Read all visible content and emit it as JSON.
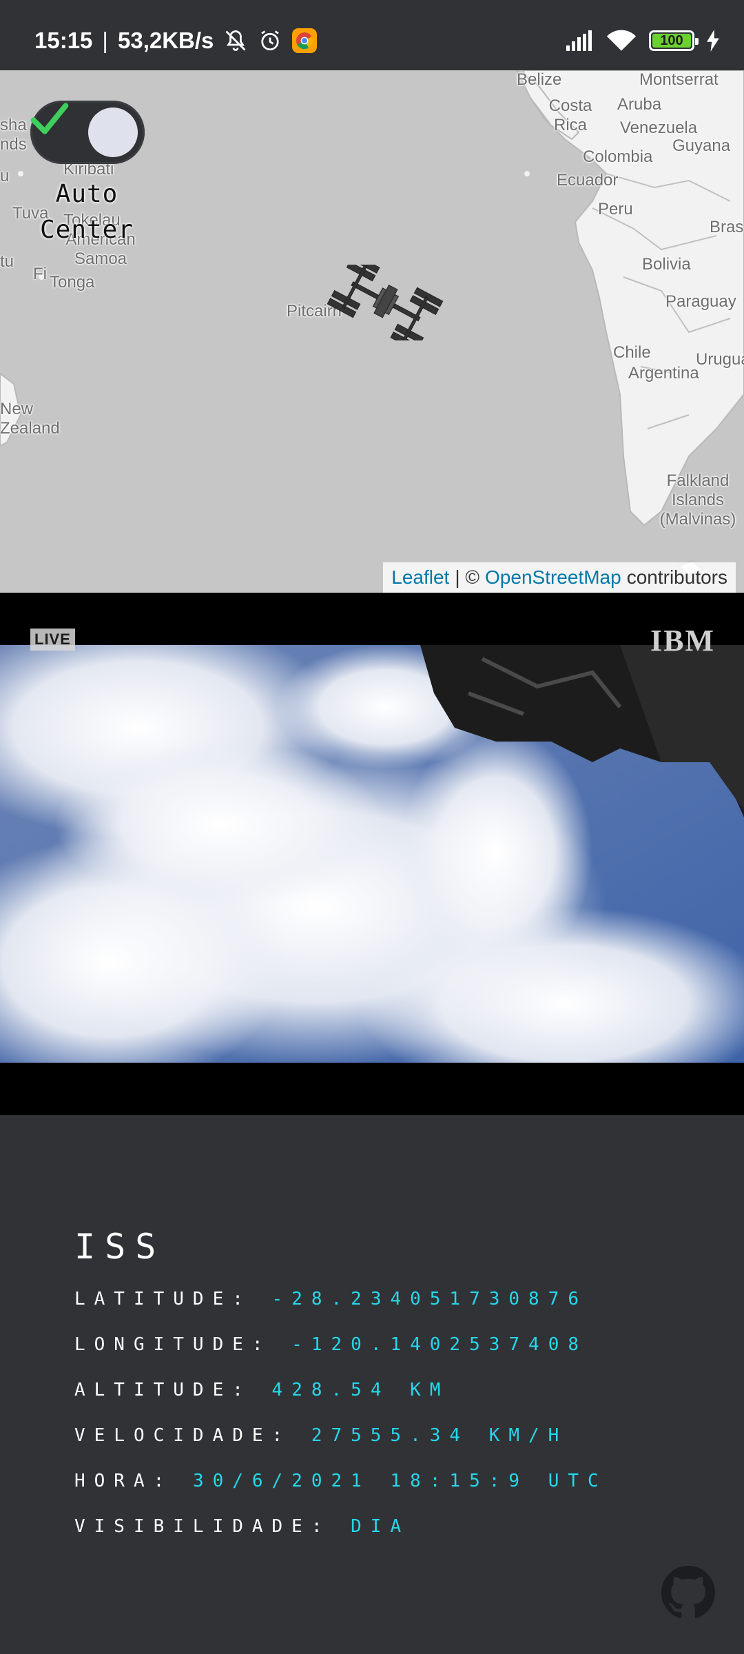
{
  "status_bar": {
    "time": "15:15",
    "network_speed": "53,2KB/s",
    "battery": "100",
    "icons": [
      "mute-icon",
      "alarm-icon",
      "chrome-icon",
      "signal-icon",
      "wifi-icon",
      "battery-icon",
      "charging-icon"
    ]
  },
  "map": {
    "toggle": {
      "label": "Auto Center",
      "checked": true
    },
    "labels": {
      "belize": "Belize",
      "montserrat": "Montserrat",
      "costa_rica": "Costa Rica",
      "aruba": "Aruba",
      "venezuela": "Venezuela",
      "guyana": "Guyana",
      "colombia": "Colombia",
      "ecuador": "Ecuador",
      "peru": "Peru",
      "brasil": "Bras",
      "bolivia": "Bolivia",
      "paraguay": "Paraguay",
      "chile": "Chile",
      "argentina": "Argentina",
      "uruguay": "Urugua",
      "falkland": "Falkland Islands (Malvinas)",
      "kiribati": "Kiribati",
      "tuvalu": "Tuva",
      "tokelau": "Tokelau",
      "american_samoa": "American Samoa",
      "fiji": "Fi",
      "tonga": "Tonga",
      "pitcairn": "Pitcairn",
      "new_zealand": "New Zealand",
      "marshall": "sha",
      "islands": "nds",
      "tu": "tu",
      "u": "u"
    },
    "attribution": {
      "leaflet": "Leaflet",
      "separator": "| ©",
      "osm": "OpenStreetMap",
      "suffix": "contributors"
    }
  },
  "video": {
    "live": "LIVE",
    "brand": "IBM"
  },
  "info": {
    "title": "ISS",
    "rows": [
      {
        "label": "LATITUDE:",
        "value": "-28.234051730876"
      },
      {
        "label": "LONGITUDE:",
        "value": "-120.1402537408"
      },
      {
        "label": "ALTITUDE:",
        "value": "428.54 KM"
      },
      {
        "label": "VELOCIDADE:",
        "value": "27555.34 KM/H"
      },
      {
        "label": "HORA:",
        "value": "30/6/2021 18:15:9 UTC"
      },
      {
        "label": "VISIBILIDADE:",
        "value": "DIA"
      }
    ]
  },
  "colors": {
    "background": "#303236",
    "accent": "#26d7ea",
    "map_water": "#c6c6c6",
    "map_land": "#f2f2f2",
    "toggle_check": "#3fcf5c"
  }
}
